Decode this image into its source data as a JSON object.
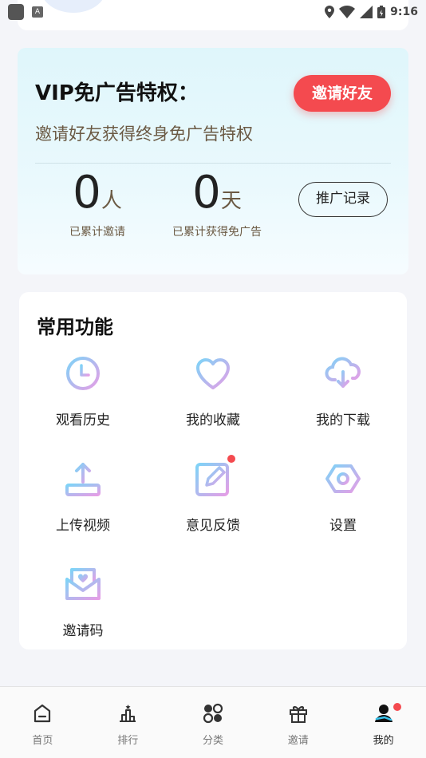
{
  "status_bar": {
    "time": "9:16",
    "badge_letter": "A"
  },
  "vip": {
    "title": "VIP免广告特权：",
    "invite_button": "邀请好友",
    "subtitle": "邀请好友获得终身免广告特权",
    "invited_count": "0",
    "invited_unit": "人",
    "invited_label": "已累计邀请",
    "days_count": "0",
    "days_unit": "天",
    "days_label": "已累计获得免广告",
    "promo_button": "推广记录"
  },
  "functions": {
    "title": "常用功能",
    "items": [
      {
        "label": "观看历史",
        "icon": "clock-icon"
      },
      {
        "label": "我的收藏",
        "icon": "heart-icon"
      },
      {
        "label": "我的下载",
        "icon": "cloud-download-icon"
      },
      {
        "label": "上传视频",
        "icon": "upload-icon"
      },
      {
        "label": "意见反馈",
        "icon": "edit-feedback-icon"
      },
      {
        "label": "设置",
        "icon": "hexagon-settings-icon"
      },
      {
        "label": "邀请码",
        "icon": "envelope-heart-icon"
      }
    ]
  },
  "nav": {
    "items": [
      {
        "label": "首页",
        "icon": "home-icon"
      },
      {
        "label": "排行",
        "icon": "ranking-icon"
      },
      {
        "label": "分类",
        "icon": "category-icon"
      },
      {
        "label": "邀请",
        "icon": "gift-icon"
      },
      {
        "label": "我的",
        "icon": "profile-icon"
      }
    ],
    "active_index": 4
  },
  "colors": {
    "accent_red": "#f44a4f",
    "brown_text": "#6b5a44",
    "icon_gradient_start": "#7fd3f7",
    "icon_gradient_end": "#e59ee6"
  }
}
